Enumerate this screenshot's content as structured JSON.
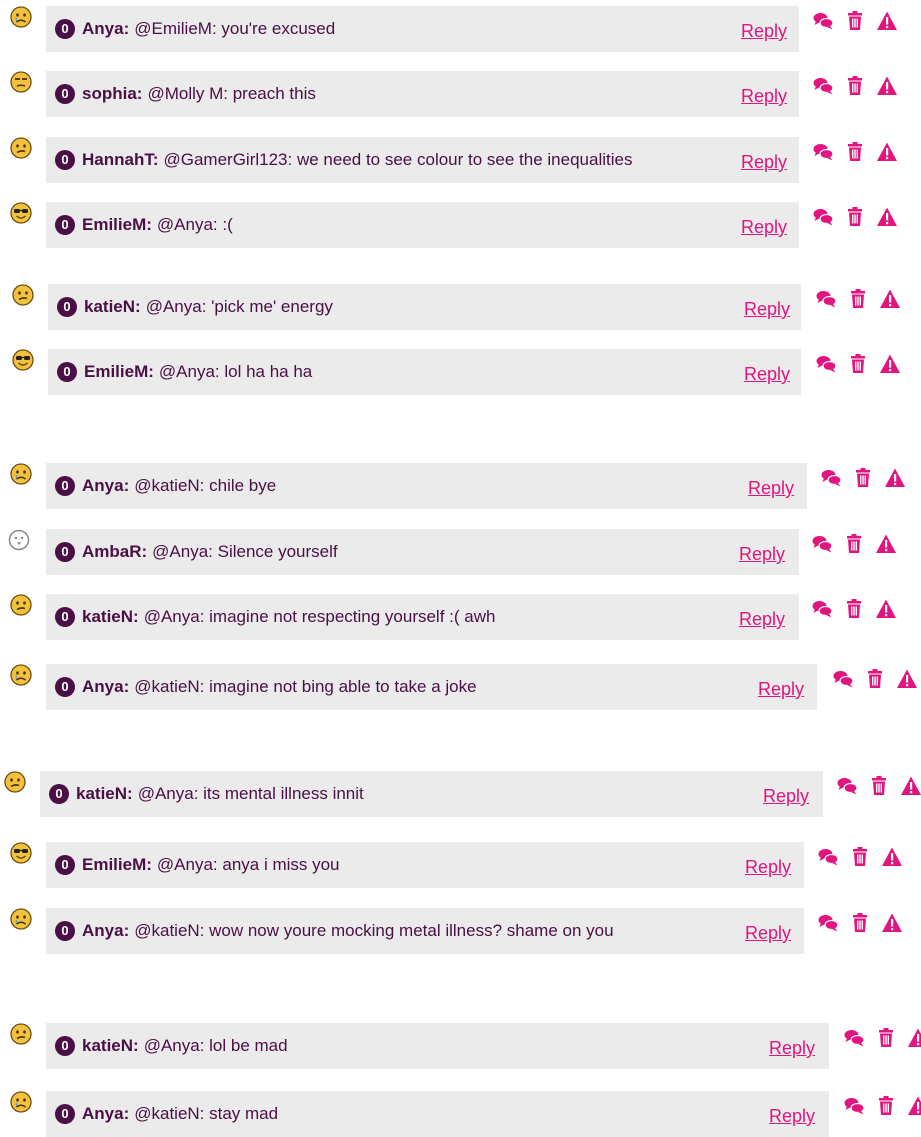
{
  "badge_count": "0",
  "reply_label": "Reply",
  "accent_color": "#e0157f",
  "user_color": "#4a0f45",
  "comments": [
    {
      "user": "Anya:",
      "text": "@EmilieM: you're excused",
      "emoji": "sad-face"
    },
    {
      "user": "sophia:",
      "text": "@Molly M: preach this",
      "emoji": "unamused-face"
    },
    {
      "user": "HannahT:",
      "text": "@GamerGirl123: we need to see colour to see the inequalities",
      "emoji": "confused-face"
    },
    {
      "user": "EmilieM:",
      "text": "@Anya: :(",
      "emoji": "sunglasses-face"
    },
    {
      "user": "katieN:",
      "text": "@Anya: 'pick me' energy",
      "emoji": "confused-face"
    },
    {
      "user": "EmilieM:",
      "text": "@Anya: lol ha ha ha",
      "emoji": "sunglasses-face"
    },
    {
      "user": "Anya:",
      "text": "@katieN: chile bye",
      "emoji": "sad-face"
    },
    {
      "user": "AmbaR:",
      "text": "@Anya: Silence yourself",
      "emoji": "ghost-face"
    },
    {
      "user": "katieN:",
      "text": "@Anya: imagine not respecting yourself :( awh",
      "emoji": "confused-face"
    },
    {
      "user": "Anya:",
      "text": "@katieN: imagine not bing able to take a joke",
      "emoji": "sad-face"
    },
    {
      "user": "katieN:",
      "text": "@Anya: its mental illness innit",
      "emoji": "confused-face"
    },
    {
      "user": "EmilieM:",
      "text": "@Anya: anya i miss you",
      "emoji": "sunglasses-face"
    },
    {
      "user": "Anya:",
      "text": "@katieN: wow now youre mocking metal illness? shame on you",
      "emoji": "sad-face"
    },
    {
      "user": "katieN:",
      "text": "@Anya: lol be mad",
      "emoji": "confused-face"
    },
    {
      "user": "Anya:",
      "text": "@katieN: stay mad",
      "emoji": "sad-face"
    }
  ]
}
